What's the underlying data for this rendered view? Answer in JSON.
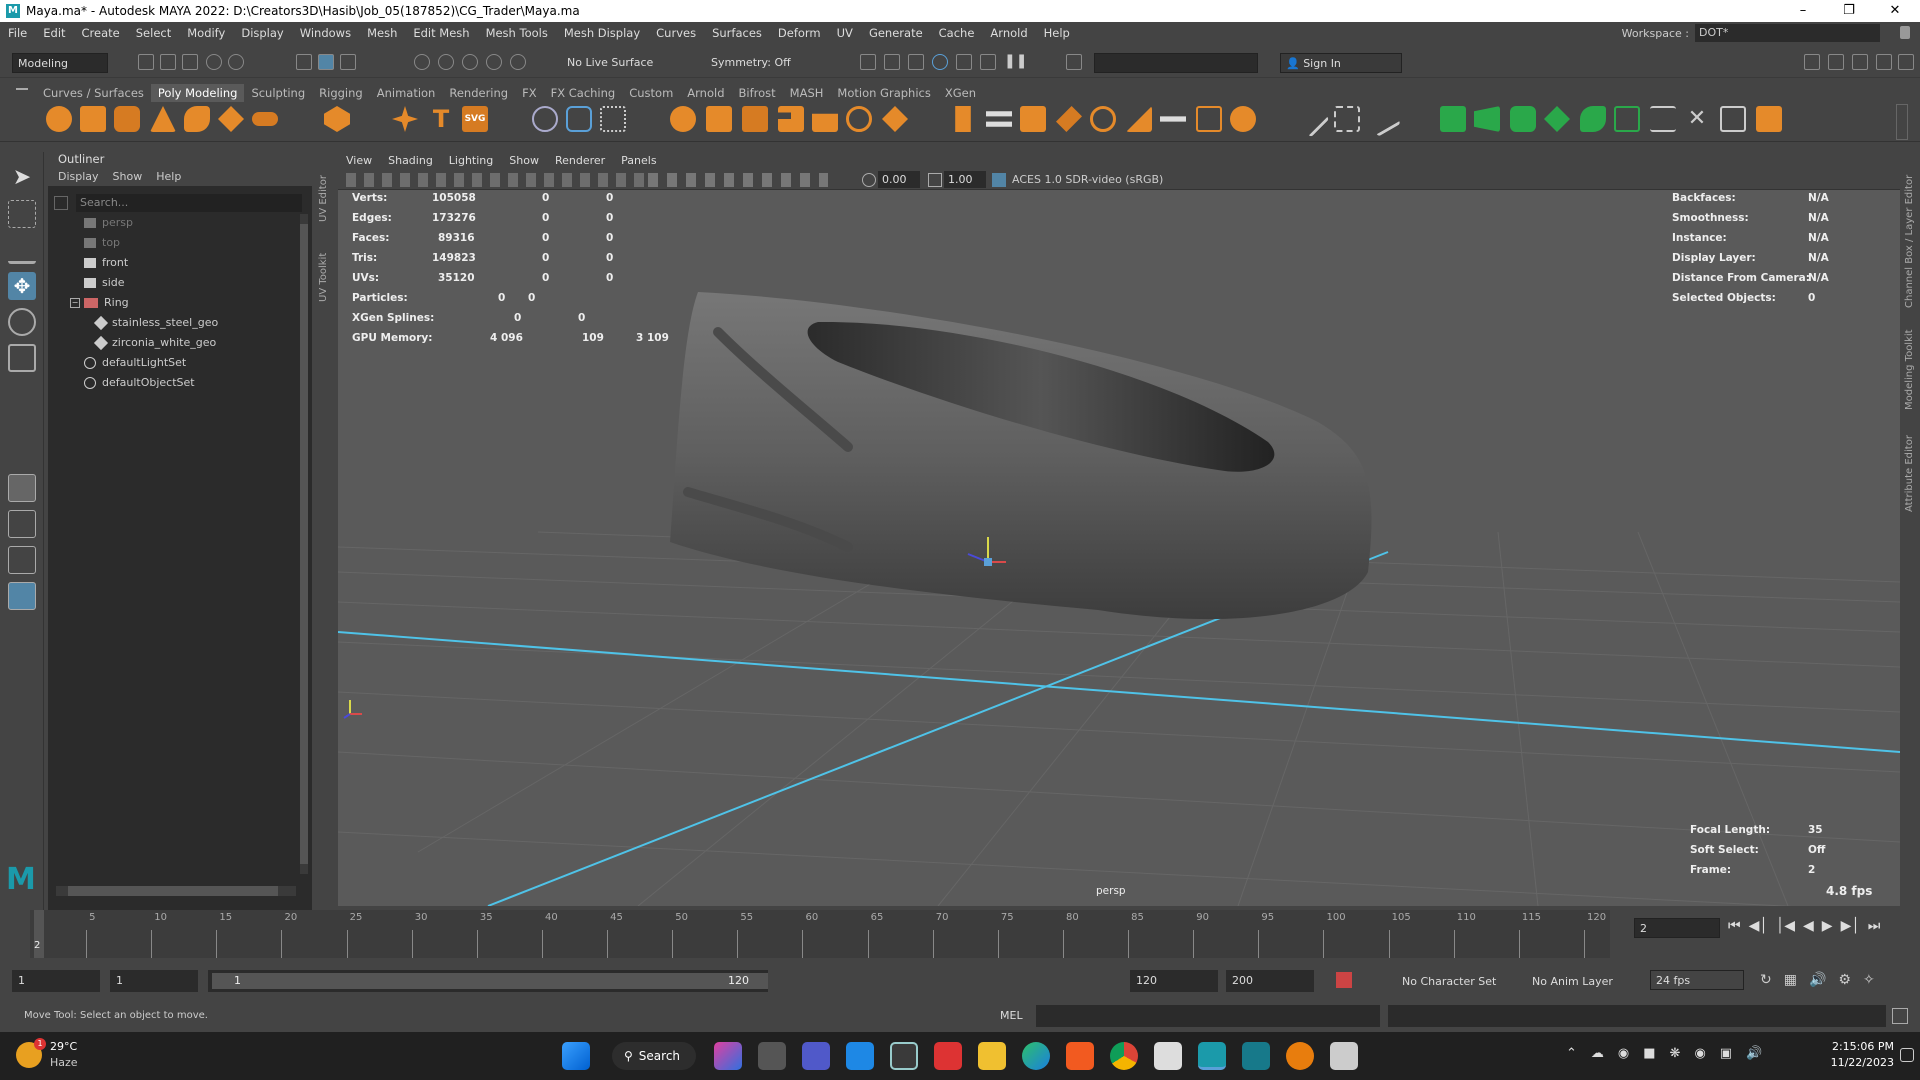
{
  "window": {
    "title": "Maya.ma* - Autodesk MAYA 2022: D:\\Creators3D\\Hasib\\Job_05(187852)\\CG_Trader\\Maya.ma"
  },
  "menubar": {
    "items": [
      "File",
      "Edit",
      "Create",
      "Select",
      "Modify",
      "Display",
      "Windows",
      "Mesh",
      "Edit Mesh",
      "Mesh Tools",
      "Mesh Display",
      "Curves",
      "Surfaces",
      "Deform",
      "UV",
      "Generate",
      "Cache",
      "Arnold",
      "Help"
    ],
    "workspace_label": "Workspace :",
    "workspace_value": "DOT*"
  },
  "statusline": {
    "mode": "Modeling",
    "live_surface": "No Live Surface",
    "symmetry": "Symmetry: Off",
    "sign_in": "Sign In"
  },
  "shelf": {
    "tabs": [
      "Curves / Surfaces",
      "Poly Modeling",
      "Sculpting",
      "Rigging",
      "Animation",
      "Rendering",
      "FX",
      "FX Caching",
      "Custom",
      "Arnold",
      "Bifrost",
      "MASH",
      "Motion Graphics",
      "XGen"
    ],
    "active": "Poly Modeling",
    "svg_label": "SVG",
    "text_label": "T"
  },
  "outliner": {
    "title": "Outliner",
    "menu": [
      "Display",
      "Show",
      "Help"
    ],
    "search_placeholder": "Search...",
    "items": [
      {
        "label": "persp",
        "dim": true
      },
      {
        "label": "top",
        "dim": true
      },
      {
        "label": "front",
        "dim": false
      },
      {
        "label": "side",
        "dim": false
      },
      {
        "label": "Ring",
        "dim": false
      },
      {
        "label": "stainless_steel_geo",
        "dim": false
      },
      {
        "label": "zirconia_white_geo",
        "dim": false
      },
      {
        "label": "defaultLightSet",
        "dim": false
      },
      {
        "label": "defaultObjectSet",
        "dim": false
      }
    ]
  },
  "side_labels": {
    "uv_editor": "UV Editor",
    "uv_toolkit": "UV Toolkit",
    "channel_box": "Channel Box / Layer Editor",
    "modeling_toolkit": "Modeling Toolkit",
    "attribute_editor": "Attribute Editor"
  },
  "viewport": {
    "menu": [
      "View",
      "Shading",
      "Lighting",
      "Show",
      "Renderer",
      "Panels"
    ],
    "exposure": "0.00",
    "gamma": "1.00",
    "color_space": "ACES 1.0 SDR-video (sRGB)",
    "camera": "persp",
    "hud_left": [
      {
        "label": "Verts:",
        "a": "105058",
        "b": "0",
        "c": "0"
      },
      {
        "label": "Edges:",
        "a": "173276",
        "b": "0",
        "c": "0"
      },
      {
        "label": "Faces:",
        "a": "89316",
        "b": "0",
        "c": "0"
      },
      {
        "label": "Tris:",
        "a": "149823",
        "b": "0",
        "c": "0"
      },
      {
        "label": "UVs:",
        "a": "35120",
        "b": "0",
        "c": "0"
      },
      {
        "label": "Particles:",
        "a": "0",
        "b": "0",
        "c": ""
      },
      {
        "label": "XGen Splines:",
        "a": "0",
        "b": "0",
        "c": ""
      },
      {
        "label": "GPU Memory:",
        "a": "4 096",
        "b": "109",
        "c": "3 109"
      }
    ],
    "hud_right": [
      {
        "label": "Backfaces:",
        "value": "N/A"
      },
      {
        "label": "Smoothness:",
        "value": "N/A"
      },
      {
        "label": "Instance:",
        "value": "N/A"
      },
      {
        "label": "Display Layer:",
        "value": "N/A"
      },
      {
        "label": "Distance From Camera:",
        "value": "N/A"
      },
      {
        "label": "Selected Objects:",
        "value": "0"
      }
    ],
    "hud_bottom": [
      {
        "label": "Focal Length:",
        "value": "35"
      },
      {
        "label": "Soft Select:",
        "value": "Off"
      },
      {
        "label": "Frame:",
        "value": "2"
      }
    ],
    "fps": "4.8 fps"
  },
  "timeline": {
    "ticks": [
      "5",
      "10",
      "15",
      "20",
      "25",
      "30",
      "35",
      "40",
      "45",
      "50",
      "55",
      "60",
      "65",
      "70",
      "75",
      "80",
      "85",
      "90",
      "95",
      "100",
      "105",
      "110",
      "115",
      "120"
    ],
    "current_frame_marker": "2",
    "current_frame_field": "2"
  },
  "range": {
    "start": "1",
    "start2": "1",
    "slider_start": "1",
    "slider_end": "120",
    "end": "120",
    "end2": "200",
    "character_set": "No Character Set",
    "anim_layer": "No Anim Layer",
    "fps": "24 fps"
  },
  "commandline": {
    "mel": "MEL",
    "help": "Move Tool: Select an object to move."
  },
  "taskbar": {
    "weather_temp": "29°C",
    "weather_desc": "Haze",
    "weather_badge": "1",
    "search": "Search",
    "time": "2:15:06 PM",
    "date": "11/22/2023"
  },
  "colors": {
    "accent_blue": "#5aa0d8",
    "grid_axis": "#4fc3e8",
    "viewport_bg": "#5a5a5a",
    "active_tool": "#5285a6"
  }
}
